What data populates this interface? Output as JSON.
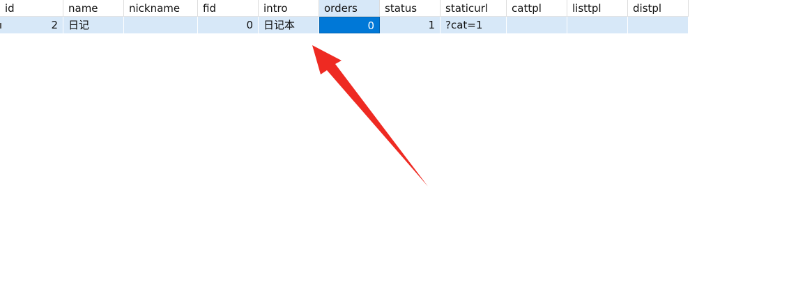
{
  "table": {
    "columns": [
      {
        "key": "id",
        "label": "id"
      },
      {
        "key": "name",
        "label": "name"
      },
      {
        "key": "nickname",
        "label": "nickname"
      },
      {
        "key": "fid",
        "label": "fid"
      },
      {
        "key": "intro",
        "label": "intro"
      },
      {
        "key": "orders",
        "label": "orders"
      },
      {
        "key": "status",
        "label": "status"
      },
      {
        "key": "staticurl",
        "label": "staticurl"
      },
      {
        "key": "cattpl",
        "label": "cattpl"
      },
      {
        "key": "listtpl",
        "label": "listtpl"
      },
      {
        "key": "distpl",
        "label": "distpl"
      }
    ],
    "rows": [
      {
        "id": "2",
        "name": "日记",
        "nickname": "",
        "fid": "0",
        "intro": "日记本",
        "orders": "0",
        "status": "1",
        "staticurl": "?cat=1",
        "cattpl": "",
        "listtpl": "",
        "distpl": ""
      }
    ],
    "selected_column": "orders",
    "colors": {
      "row_highlight": "#d7e8f8",
      "selected_cell": "#0078d7",
      "annotation_arrow": "#ee2a22"
    }
  },
  "annotation": {
    "icon": "red-arrow-icon"
  }
}
